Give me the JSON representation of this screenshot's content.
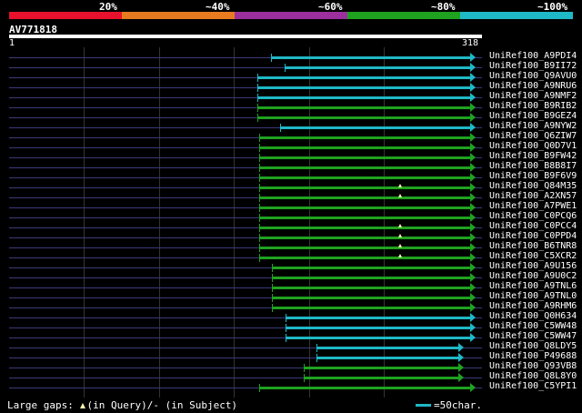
{
  "legend": {
    "labels": [
      "20%",
      "~40%",
      "~60%",
      "~80%",
      "~100%"
    ],
    "colors": [
      "#e8112d",
      "#e87a1f",
      "#9b2f9e",
      "#1fa21f",
      "#1fb8c6"
    ]
  },
  "query": {
    "title": "AV771818",
    "start": "1",
    "end": "318"
  },
  "hits": [
    {
      "name": "UniRef100_A9PDI4",
      "start": 176,
      "end": 310,
      "color": "cyan"
    },
    {
      "name": "UniRef100_B9II72",
      "start": 185,
      "end": 310,
      "color": "cyan"
    },
    {
      "name": "UniRef100_Q9AVU0",
      "start": 167,
      "end": 310,
      "color": "cyan"
    },
    {
      "name": "UniRef100_A9NRU6",
      "start": 167,
      "end": 310,
      "color": "cyan"
    },
    {
      "name": "UniRef100_A9NMF2",
      "start": 167,
      "end": 310,
      "color": "cyan"
    },
    {
      "name": "UniRef100_B9RIB2",
      "start": 167,
      "end": 310,
      "color": "green"
    },
    {
      "name": "UniRef100_B9GEZ4",
      "start": 167,
      "end": 310,
      "color": "green"
    },
    {
      "name": "UniRef100_A9NYW2",
      "start": 182,
      "end": 310,
      "color": "cyan"
    },
    {
      "name": "UniRef100_Q6ZIW7",
      "start": 168,
      "end": 310,
      "color": "green"
    },
    {
      "name": "UniRef100_Q0D7V1",
      "start": 168,
      "end": 310,
      "color": "green"
    },
    {
      "name": "UniRef100_B9FW42",
      "start": 168,
      "end": 310,
      "color": "green"
    },
    {
      "name": "UniRef100_B8B8I7",
      "start": 168,
      "end": 310,
      "color": "green"
    },
    {
      "name": "UniRef100_B9F6V9",
      "start": 168,
      "end": 310,
      "color": "green"
    },
    {
      "name": "UniRef100_Q84M35",
      "start": 168,
      "end": 310,
      "color": "green",
      "mark": 263
    },
    {
      "name": "UniRef100_A2XN57",
      "start": 168,
      "end": 310,
      "color": "green",
      "mark": 263
    },
    {
      "name": "UniRef100_A7PWE1",
      "start": 168,
      "end": 310,
      "color": "green"
    },
    {
      "name": "UniRef100_C0PCQ6",
      "start": 168,
      "end": 310,
      "color": "green"
    },
    {
      "name": "UniRef100_C0PCC4",
      "start": 168,
      "end": 310,
      "color": "green",
      "mark": 263
    },
    {
      "name": "UniRef100_C0PPD4",
      "start": 168,
      "end": 310,
      "color": "green",
      "mark": 263
    },
    {
      "name": "UniRef100_B6TNR8",
      "start": 168,
      "end": 310,
      "color": "green",
      "mark": 263
    },
    {
      "name": "UniRef100_C5XCR2",
      "start": 168,
      "end": 310,
      "color": "green",
      "mark": 263
    },
    {
      "name": "UniRef100_A9U156",
      "start": 177,
      "end": 310,
      "color": "green"
    },
    {
      "name": "UniRef100_A9U0C2",
      "start": 177,
      "end": 310,
      "color": "green"
    },
    {
      "name": "UniRef100_A9TNL6",
      "start": 177,
      "end": 310,
      "color": "green"
    },
    {
      "name": "UniRef100_A9TNL0",
      "start": 177,
      "end": 310,
      "color": "green"
    },
    {
      "name": "UniRef100_A9RHM6",
      "start": 177,
      "end": 310,
      "color": "green"
    },
    {
      "name": "UniRef100_Q0H634",
      "start": 186,
      "end": 310,
      "color": "cyan"
    },
    {
      "name": "UniRef100_C5WW48",
      "start": 186,
      "end": 310,
      "color": "cyan"
    },
    {
      "name": "UniRef100_C5WW47",
      "start": 186,
      "end": 310,
      "color": "cyan"
    },
    {
      "name": "UniRef100_Q8LDY5",
      "start": 207,
      "end": 302,
      "color": "cyan"
    },
    {
      "name": "UniRef100_P49688",
      "start": 207,
      "end": 302,
      "color": "cyan"
    },
    {
      "name": "UniRef100_Q93VB8",
      "start": 198,
      "end": 302,
      "color": "green"
    },
    {
      "name": "UniRef100_Q8L8Y0",
      "start": 198,
      "end": 302,
      "color": "green"
    },
    {
      "name": "UniRef100_C5YPI1",
      "start": 168,
      "end": 310,
      "color": "green"
    }
  ],
  "footer": {
    "gaps_prefix": "Large gaps:",
    "gaps_query": "(in Query)/",
    "gaps_subject": "- (in Subject)",
    "scale_label": "=50char."
  }
}
